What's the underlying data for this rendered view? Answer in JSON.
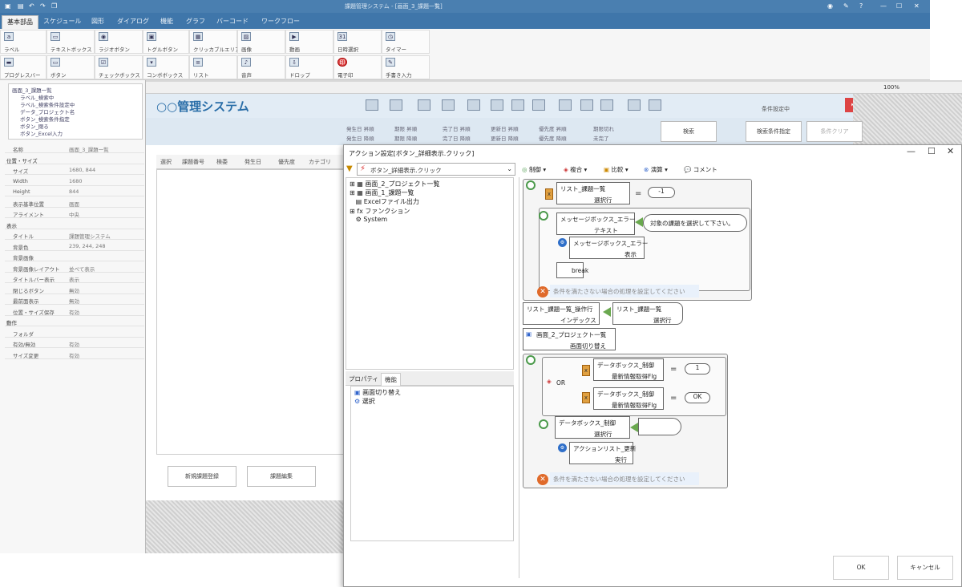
{
  "window": {
    "title": "課題管理システム - [画面_3_課題一覧]"
  },
  "tabs": [
    "基本部品",
    "スケジュール",
    "図形",
    "ダイアログ",
    "機能",
    "グラフ",
    "バーコード",
    "ワークフロー"
  ],
  "ribbon_row1": [
    "ラベル",
    "テキストボックス",
    "ラジオボタン",
    "トグルボタン",
    "クリッカブルエリア",
    "画像",
    "動画",
    "日時選択",
    "タイマー"
  ],
  "ribbon_row2": [
    "プログレスバー",
    "ボタン",
    "チェックボックス",
    "コンボボックス",
    "リスト",
    "音声",
    "ドロップ",
    "電子印",
    "手書き入力"
  ],
  "zoom": "100%",
  "tree": [
    "画面_3_課題一覧",
    "ラベル_検索中",
    "ラベル_検索条件設定中",
    "データ_プロジェクト名",
    "ボタン_検索条件指定",
    "ボタン_閉る",
    "ボタン_Excel入力"
  ],
  "props": [
    {
      "k": "名称",
      "v": "画面_3_課題一覧",
      "sec": false
    },
    {
      "k": "位置・サイズ",
      "v": "",
      "sec": true
    },
    {
      "k": "サイズ",
      "v": "1680, 844",
      "sec": false
    },
    {
      "k": "Width",
      "v": "1680",
      "sec": false
    },
    {
      "k": "Height",
      "v": "844",
      "sec": false
    },
    {
      "k": "表示基準位置",
      "v": "画面",
      "sec": false
    },
    {
      "k": "アライメント",
      "v": "中央",
      "sec": false
    },
    {
      "k": "表示",
      "v": "",
      "sec": true
    },
    {
      "k": "タイトル",
      "v": "課題管理システム",
      "sec": false
    },
    {
      "k": "背景色",
      "v": "239, 244, 248",
      "sec": false
    },
    {
      "k": "背景画像",
      "v": "",
      "sec": false
    },
    {
      "k": "背景画像レイアウト",
      "v": "並べて表示",
      "sec": false
    },
    {
      "k": "タイトルバー表示",
      "v": "表示",
      "sec": false
    },
    {
      "k": "閉じるボタン",
      "v": "無効",
      "sec": false
    },
    {
      "k": "最前面表示",
      "v": "無効",
      "sec": false
    },
    {
      "k": "位置・サイズ保存",
      "v": "有効",
      "sec": false
    },
    {
      "k": "動作",
      "v": "",
      "sec": true
    },
    {
      "k": "フォルダ",
      "v": "",
      "sec": false
    },
    {
      "k": "有効/無効",
      "v": "有効",
      "sec": false
    },
    {
      "k": "サイズ変更",
      "v": "有効",
      "sec": false
    }
  ],
  "app": {
    "title": "○○管理システム",
    "cond": "条件設定中"
  },
  "filters": [
    "発生日 昇順",
    "期限 昇順",
    "完了日 昇順",
    "更新日 昇順",
    "優先度 昇順",
    "期限切れ",
    "発生日 降順",
    "期限 降順",
    "完了日 降順",
    "更新日 降順",
    "優先度 降順",
    "未完了"
  ],
  "buttons": {
    "search": "検索",
    "cond": "検索条件指定",
    "clear": "条件クリア",
    "new": "新規課題登録",
    "edit": "課題編集"
  },
  "table_headers": [
    "選択",
    "課題番号",
    "検委",
    "発生日",
    "優先度",
    "カテゴリ"
  ],
  "dialog": {
    "title": "アクション設定[ボタン_詳細表示.クリック]",
    "select": "ボタン_詳細表示.クリック",
    "toolbar": [
      "制御",
      "複合",
      "比較",
      "演算",
      "コメント"
    ],
    "tree": [
      "画面_2_プロジェクト一覧",
      "画面_1_課題一覧",
      "Excelファイル出力",
      "ファンクション",
      "System"
    ],
    "subtabs": [
      "プロパティ",
      "機能"
    ],
    "sublist": [
      "画面切り替え",
      "選択"
    ],
    "ok": "OK",
    "cancel": "キャンセル"
  },
  "flow": {
    "b1": {
      "obj": "リスト_課題一覧",
      "prop": "選択行",
      "op": "=",
      "val": "-1"
    },
    "b2": {
      "obj": "メッセージボックス_エラー",
      "prop": "テキスト",
      "val": "対象の課題を選択して下さい。"
    },
    "b3": {
      "obj": "メッセージボックス_エラー",
      "prop": "表示"
    },
    "brk": "break",
    "else1": "条件を満たさない場合の処理を設定してください",
    "b4": {
      "obj": "リスト_課題一覧_操作行",
      "prop": "インデックス",
      "src": "リスト_課題一覧",
      "srcprop": "選択行"
    },
    "b5": {
      "obj": "画面_2_プロジェクト一覧",
      "prop": "画面切り替え"
    },
    "or": "OR",
    "b6": {
      "obj": "データボックス_制御",
      "prop": "最新情報取得Flg",
      "op": "=",
      "val": "1"
    },
    "b7": {
      "obj": "データボックス_制御",
      "prop": "最新情報取得Flg",
      "op": "=",
      "val": "OK"
    },
    "b8": {
      "obj": "データボックス_制御",
      "prop": "選択行"
    },
    "b9": {
      "obj": "アクションリスト_更新",
      "prop": "実行"
    },
    "else2": "条件を満たさない場合の処理を設定してください"
  }
}
